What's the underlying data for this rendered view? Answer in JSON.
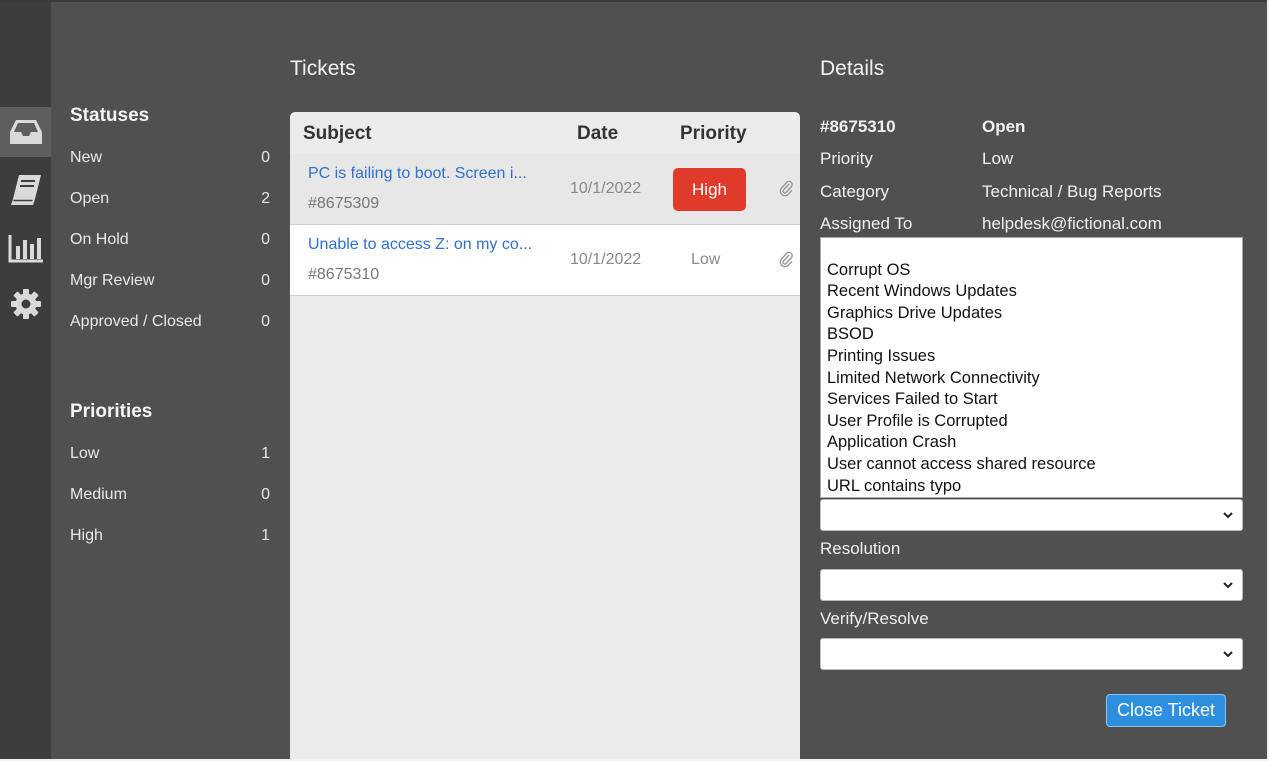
{
  "colors": {
    "accent_blue": "#2c8fe0",
    "high_red": "#e03a2a",
    "link_blue": "#2f6fd0",
    "bg": "#505050",
    "rail": "#3d3d3d"
  },
  "rail": {
    "icons": [
      "inbox-icon",
      "book-icon",
      "bar-chart-icon",
      "gear-icon"
    ],
    "active": "inbox-icon"
  },
  "statuses": {
    "heading": "Statuses",
    "items": [
      {
        "label": "New",
        "count": "0"
      },
      {
        "label": "Open",
        "count": "2"
      },
      {
        "label": "On Hold",
        "count": "0"
      },
      {
        "label": "Mgr Review",
        "count": "0"
      },
      {
        "label": "Approved / Closed",
        "count": "0"
      }
    ]
  },
  "priorities": {
    "heading": "Priorities",
    "items": [
      {
        "label": "Low",
        "count": "1"
      },
      {
        "label": "Medium",
        "count": "0"
      },
      {
        "label": "High",
        "count": "1"
      }
    ]
  },
  "tickets": {
    "title": "Tickets",
    "columns": {
      "subject": "Subject",
      "date": "Date",
      "priority": "Priority"
    },
    "rows": [
      {
        "subject": "PC is failing to boot. Screen i...",
        "id": "#8675309",
        "date": "10/1/2022",
        "priority": "High"
      },
      {
        "subject": "Unable to access Z: on my co...",
        "id": "#8675310",
        "date": "10/1/2022",
        "priority": "Low"
      }
    ]
  },
  "details": {
    "title": "Details",
    "ticket_id": "#8675310",
    "status": "Open",
    "priority_label": "Priority",
    "priority_value": "Low",
    "category_label": "Category",
    "category_value": "Technical / Bug Reports",
    "assigned_label": "Assigned To",
    "assigned_value": "helpdesk@fictional.com",
    "issue_options": [
      "Corrupt OS",
      "Recent Windows Updates",
      "Graphics Drive Updates",
      "BSOD",
      "Printing Issues",
      "Limited Network Connectivity",
      "Services Failed to Start",
      "User Profile is Corrupted",
      "Application Crash",
      "User cannot access shared resource",
      "URL contains typo"
    ],
    "resolution_label": "Resolution",
    "verify_label": "Verify/Resolve",
    "close_button": "Close Ticket"
  }
}
